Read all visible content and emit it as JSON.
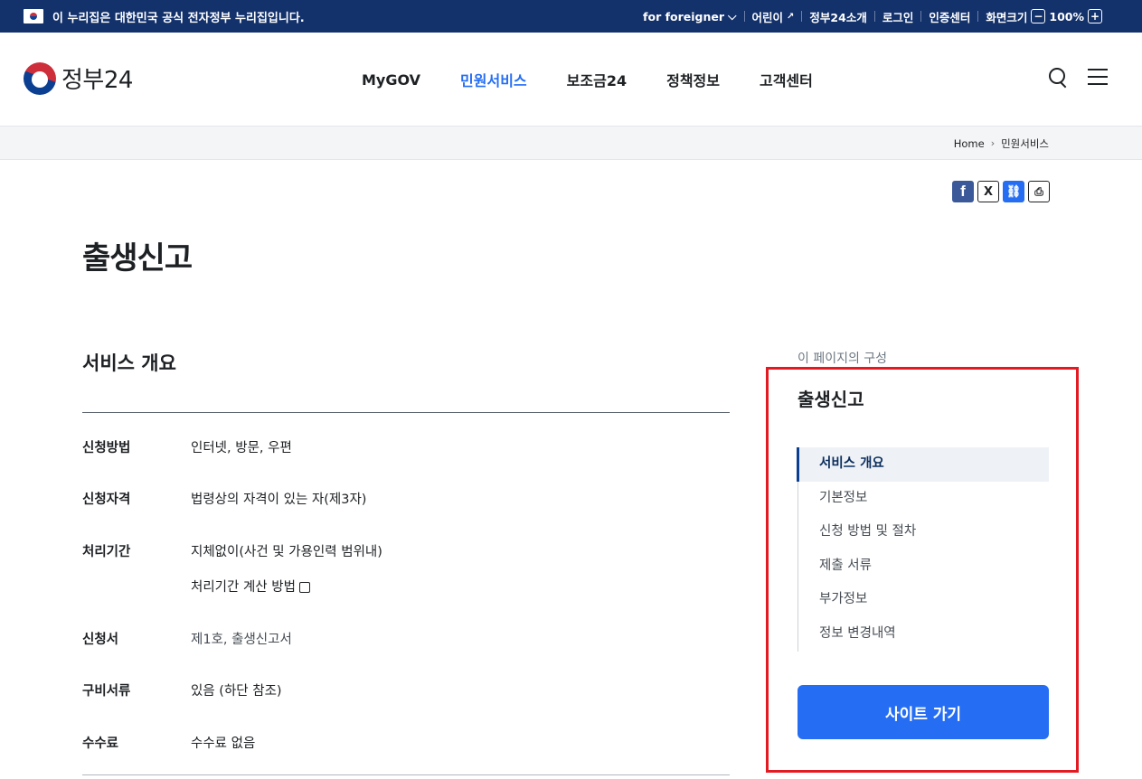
{
  "topbar": {
    "notice": "이 누리집은 대한민국 공식 전자정부 누리집입니다.",
    "for_foreigner": "for foreigner",
    "kids": "어린이",
    "about": "정부24소개",
    "login": "로그인",
    "cert_center": "인증센터",
    "zoom_label": "화면크기",
    "zoom_value": "100%"
  },
  "header": {
    "logo_text": "정부24",
    "nav": [
      "MyGOV",
      "민원서비스",
      "보조금24",
      "정책정보",
      "고객센터"
    ],
    "active_nav": "민원서비스"
  },
  "breadcrumb": {
    "home": "Home",
    "current": "민원서비스"
  },
  "page": {
    "title": "출생신고"
  },
  "overview": {
    "title": "서비스 개요",
    "rows": [
      {
        "key": "신청방법",
        "value": "인터넷, 방문, 우편"
      },
      {
        "key": "신청자격",
        "value": "법령상의 자격이 있는 자(제3자)"
      },
      {
        "key": "처리기간",
        "value": "지체없이(사건 및 가용인력 범위내)",
        "extra": "처리기간 계산 방법"
      },
      {
        "key": "신청서",
        "value": "제1호, 출생신고서"
      },
      {
        "key": "구비서류",
        "value": "있음 (하단 참조)"
      },
      {
        "key": "수수료",
        "value": "수수료 없음"
      }
    ]
  },
  "sidebar": {
    "caption": "이 페이지의 구성",
    "title": "출생신고",
    "items": [
      "서비스 개요",
      "기본정보",
      "신청 방법 및 절차",
      "제출 서류",
      "부가정보",
      "정보 변경내역"
    ],
    "button": "사이트 가기"
  },
  "colors": {
    "gov_navy": "#13316b",
    "accent_blue": "#256ef4",
    "highlight_red": "#e21b23"
  }
}
